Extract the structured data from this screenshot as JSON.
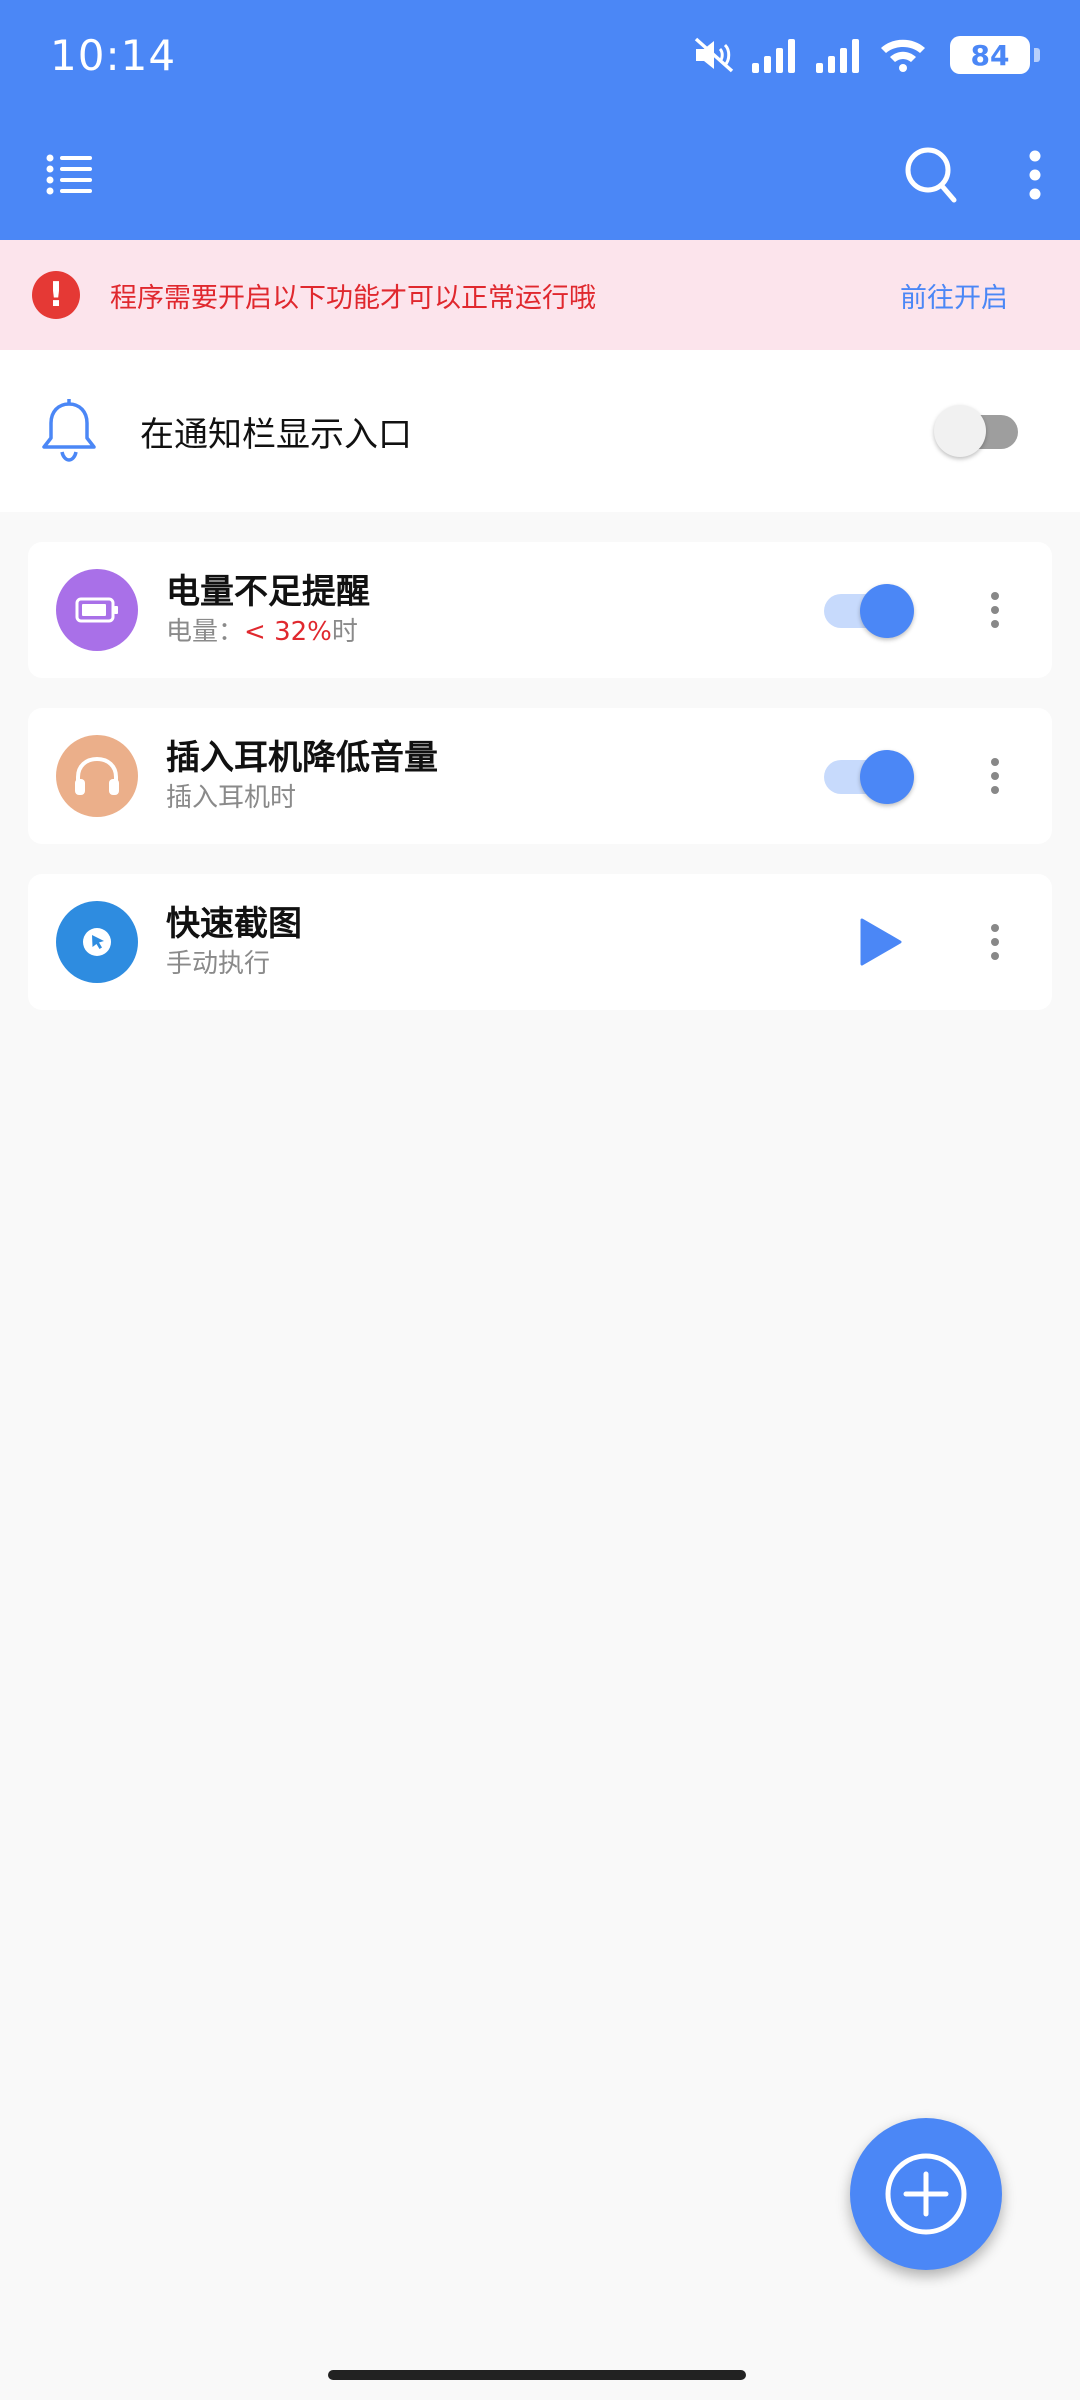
{
  "status_bar": {
    "time": "10:14",
    "battery": "84",
    "icons": [
      "mute-icon",
      "signal-icon",
      "signal-icon",
      "wifi-icon"
    ]
  },
  "toolbar": {
    "icons": [
      "list-icon",
      "search-icon",
      "more-vertical-icon"
    ]
  },
  "warning": {
    "text": "程序需要开启以下功能才可以正常运行哦",
    "action": "前往开启"
  },
  "notify_row": {
    "label": "在通知栏显示入口",
    "enabled": false
  },
  "tasks": [
    {
      "title": "电量不足提醒",
      "subtitle_prefix": "电量：",
      "subtitle_highlight": "< 32%",
      "subtitle_suffix": "时",
      "icon": "battery-icon",
      "icon_color": "#A970E8",
      "enabled": true
    },
    {
      "title": "插入耳机降低音量",
      "subtitle": "插入耳机时",
      "icon": "headphones-icon",
      "icon_color": "#EBAF8A",
      "enabled": true
    },
    {
      "title": "快速截图",
      "subtitle": "手动执行",
      "icon": "screenshot-icon",
      "icon_color": "#2E8CE0",
      "action": "play"
    }
  ],
  "colors": {
    "primary": "#4B87F6",
    "warning_bg": "#FCE4EC",
    "warning_text": "#E0282E"
  }
}
